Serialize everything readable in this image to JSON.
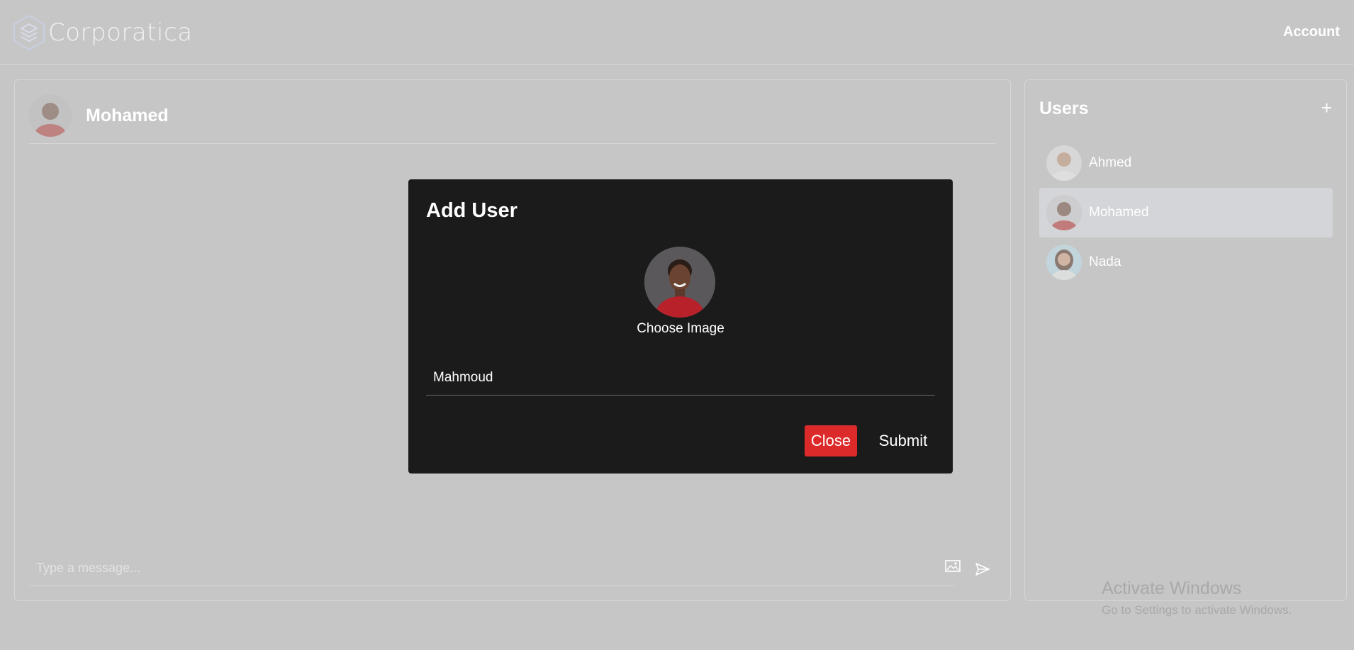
{
  "header": {
    "brand": "Corporatica",
    "account_label": "Account"
  },
  "chat": {
    "active_user": "Mohamed",
    "message_placeholder": "Type a message...",
    "icons": {
      "attach": "image-icon",
      "send": "send-icon"
    }
  },
  "users_panel": {
    "title": "Users",
    "add_label": "+",
    "users": [
      {
        "name": "Ahmed",
        "active": false
      },
      {
        "name": "Mohamed",
        "active": true
      },
      {
        "name": "Nada",
        "active": false
      }
    ]
  },
  "modal": {
    "title": "Add User",
    "choose_image_label": "Choose Image",
    "name_value": "Mahmoud",
    "close_label": "Close",
    "submit_label": "Submit"
  },
  "watermark": {
    "line1": "Activate Windows",
    "line2": "Go to Settings to activate Windows."
  },
  "colors": {
    "background": "#c6c6c6",
    "modal": "#1c1b1b",
    "close_button": "#dc2a2a",
    "active_user": "#d4d5d9"
  }
}
